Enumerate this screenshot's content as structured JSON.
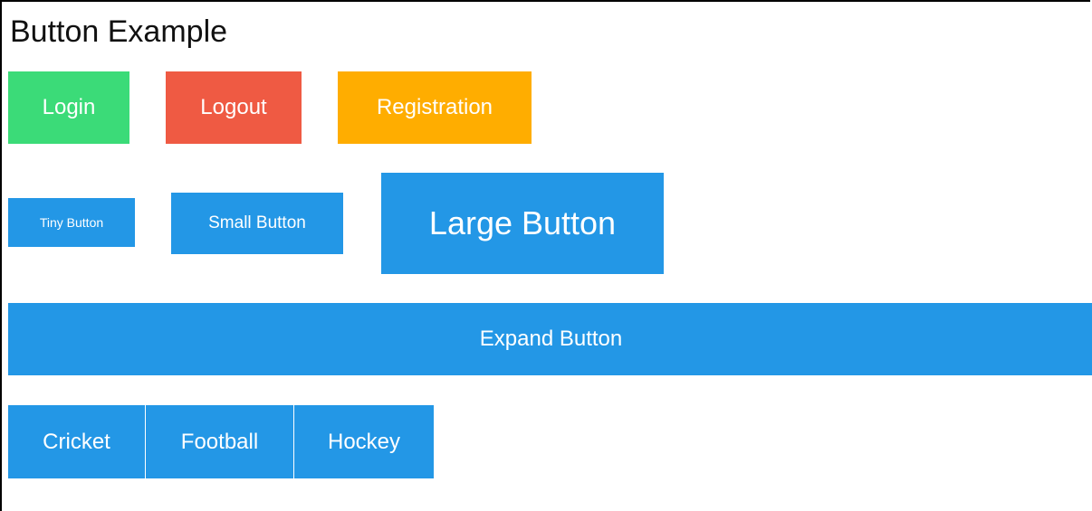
{
  "page": {
    "title": "Button Example"
  },
  "colors": {
    "login": "#3bdb78",
    "logout": "#ef5a43",
    "registration": "#ffad00",
    "primary": "#2397e6"
  },
  "row1": {
    "login_label": "Login",
    "logout_label": "Logout",
    "registration_label": "Registration"
  },
  "row2": {
    "tiny_label": "Tiny Button",
    "small_label": "Small Button",
    "large_label": "Large Button"
  },
  "row3": {
    "expand_label": "Expand Button"
  },
  "group": {
    "items": [
      {
        "label": "Cricket"
      },
      {
        "label": "Football"
      },
      {
        "label": "Hockey"
      }
    ]
  }
}
